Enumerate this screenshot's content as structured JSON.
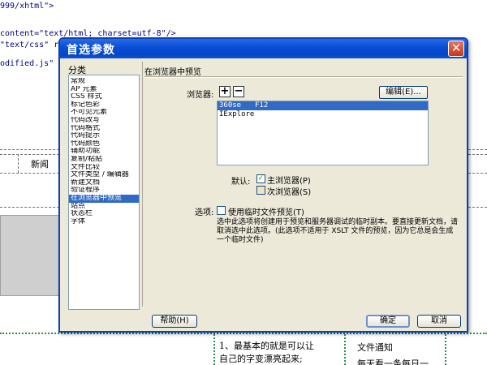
{
  "background": {
    "code_lines": [
      "999/xhtml\">",
      "content=\"text/html; charset=utf-8\"/>",
      "\"text/css\" re",
      "odified.js\" ty"
    ],
    "news_label": "新闻",
    "list_line1": "1、最基本的就是可以让",
    "list_line2": "自己的字变漂亮起来;",
    "notice_title": "文件通知",
    "notice_line": "每天看一条每日一"
  },
  "dialog": {
    "title": "首选参数",
    "close_symbol": "✕",
    "category_label": "分类",
    "categories": [
      "常规",
      "AP 元素",
      "CSS 样式",
      "标记色彩",
      "不可见元素",
      "代码改写",
      "代码格式",
      "代码提示",
      "代码颜色",
      "辅助功能",
      "复制/粘贴",
      "文件比较",
      "文件类型 / 编辑器",
      "新建文档",
      "验证程序",
      "在浏览器中预览",
      "站点",
      "状态栏",
      "字体"
    ],
    "selected_category": "在浏览器中预览",
    "section_title": "在浏览器中预览",
    "browser_label": "浏览器:",
    "add_symbol": "+",
    "remove_symbol": "−",
    "edit_button": "编辑(E)...",
    "browsers": [
      {
        "name": "360se",
        "key": "F12"
      },
      {
        "name": "IExplore",
        "key": ""
      }
    ],
    "default_label": "默认:",
    "primary_browser": "主浏览器(P)",
    "primary_checked": true,
    "secondary_browser": "次浏览器(S)",
    "secondary_checked": false,
    "options_label": "选项:",
    "temp_file_label": "使用临时文件预览(T)",
    "temp_file_checked": false,
    "description": "选中此选项将创建用于预览和服务器调试的临时副本。要直接更新文档，请取消选中此选项。(此选项不适用于 XSLT 文件的预览，因为它总是会生成一个临时文件)",
    "help_button": "帮助(H)",
    "ok_button": "确定",
    "cancel_button": "取消",
    "check_symbol": "✓"
  }
}
